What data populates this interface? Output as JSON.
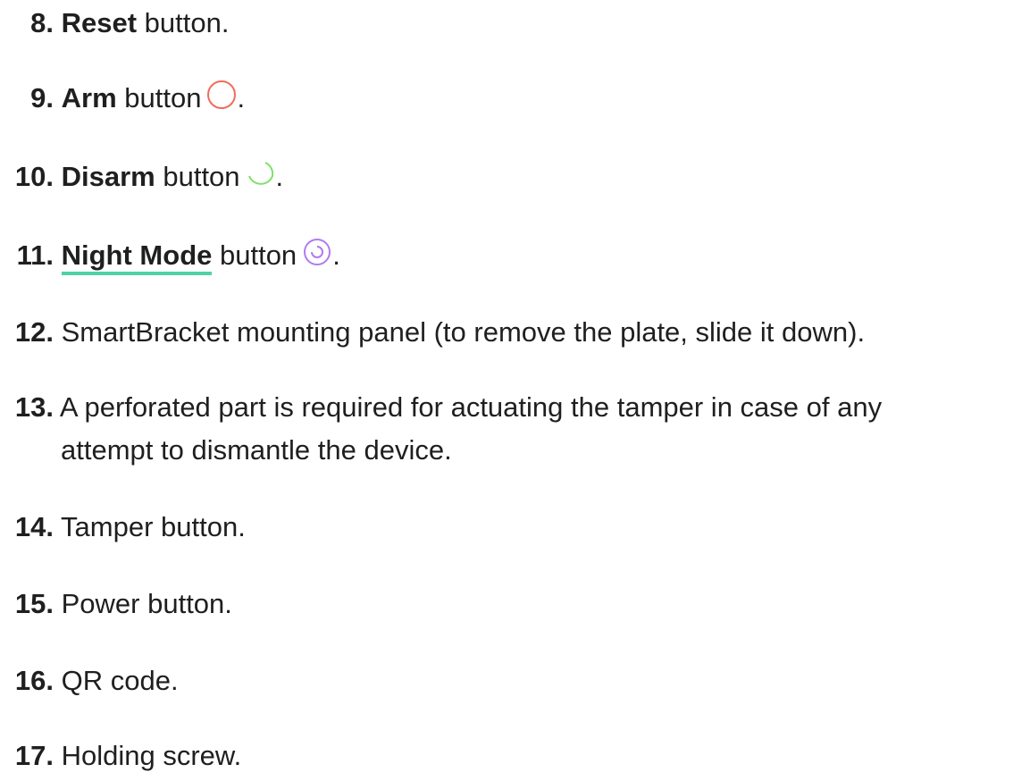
{
  "items": [
    {
      "num": "8.",
      "bold": "Reset",
      "text": " button."
    },
    {
      "num": "9.",
      "bold": "Arm",
      "text": " button",
      "after": ".",
      "icon": "arm-circle-icon",
      "icon_color": "#f26b5b"
    },
    {
      "num": "10.",
      "bold": "Disarm",
      "text": " button",
      "after": ".",
      "icon": "disarm-arc-icon",
      "icon_color": "#7ee06a"
    },
    {
      "num": "11.",
      "link": "Night Mode",
      "text": " button",
      "after": ".",
      "icon": "night-mode-icon",
      "icon_color": "#b07cf0"
    },
    {
      "num": "12.",
      "text": " SmartBracket mounting panel (to remove the plate, slide it down)."
    },
    {
      "num": "13.",
      "text": " A perforated part is required for actuating the tamper in case of any",
      "text2": "attempt to dismantle the device."
    },
    {
      "num": "14.",
      "text": " Tamper button."
    },
    {
      "num": "15.",
      "text": " Power button."
    },
    {
      "num": "16.",
      "text": " QR code."
    },
    {
      "num": "17.",
      "text": " Holding screw."
    }
  ],
  "link_underline_color": "#4fd3a5"
}
